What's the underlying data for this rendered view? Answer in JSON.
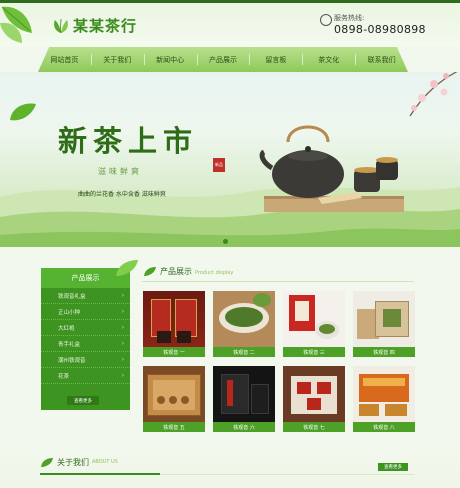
{
  "site": {
    "name": "某某茶行"
  },
  "hotline": {
    "label": "服务热线:",
    "number": "0898-08980898"
  },
  "nav": {
    "items": [
      "网站首页",
      "关于我们",
      "新闻中心",
      "产品展示",
      "留言板",
      "茶文化",
      "联系我们"
    ]
  },
  "banner": {
    "title": "新茶上市",
    "subtitle": "滋味鲜爽",
    "seal": "新品",
    "tagline": "曲曲的兰花香 水中含香 滋味鲜爽"
  },
  "sidebar": {
    "title": "产品展示",
    "items": [
      "铁观音礼盒",
      "正山小种",
      "大红袍",
      "青手礼盒",
      "潮州铁观音",
      "花茶"
    ],
    "more_label": "查看更多"
  },
  "products": {
    "title_cn": "产品展示",
    "title_en": "Product display",
    "items": [
      {
        "caption": "铁观音 一",
        "theme": "red"
      },
      {
        "caption": "铁观音 二",
        "theme": "leaf"
      },
      {
        "caption": "铁观音 三",
        "theme": "redbox"
      },
      {
        "caption": "铁观音 四",
        "theme": "kraft"
      },
      {
        "caption": "铁观音 五",
        "theme": "wood"
      },
      {
        "caption": "铁观音 六",
        "theme": "black"
      },
      {
        "caption": "铁观音 七",
        "theme": "tray"
      },
      {
        "caption": "铁观音 八",
        "theme": "gift"
      }
    ]
  },
  "about": {
    "title_cn": "关于我们",
    "title_en": "ABOUT US",
    "more_label": "查看更多"
  },
  "colors": {
    "brand": "#3b8a1c",
    "sidebar": "#3d9420",
    "nav": "#9fd26d"
  }
}
